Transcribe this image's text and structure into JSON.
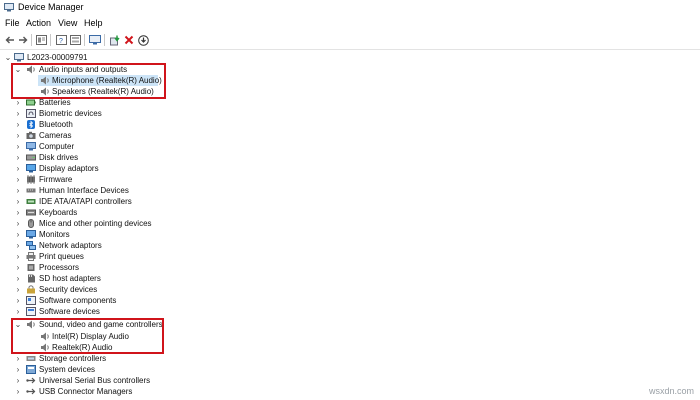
{
  "window": {
    "title": "Device Manager"
  },
  "menu": [
    "File",
    "Action",
    "View",
    "Help"
  ],
  "toolbar_icons": [
    "back-arrow-icon",
    "forward-arrow-icon",
    "properties-panel-icon",
    "help-book-icon",
    "show-hidden-icon",
    "monitor-icon",
    "update-driver-icon",
    "uninstall-x-icon",
    "scan-hardware-icon"
  ],
  "tree": {
    "root": "L2023-00009791",
    "nodes": [
      {
        "label": "Audio inputs and outputs",
        "expanded": true,
        "icon": "speaker-icon",
        "children": [
          {
            "label": "Microphone (Realtek(R) Audio)",
            "selected": true,
            "icon": "speaker-icon"
          },
          {
            "label": "Speakers (Realtek(R) Audio)",
            "icon": "speaker-icon"
          }
        ]
      },
      {
        "label": "Batteries",
        "icon": "battery-icon"
      },
      {
        "label": "Biometric devices",
        "icon": "fingerprint-icon"
      },
      {
        "label": "Bluetooth",
        "icon": "bluetooth-icon"
      },
      {
        "label": "Cameras",
        "icon": "camera-icon"
      },
      {
        "label": "Computer",
        "icon": "computer-icon"
      },
      {
        "label": "Disk drives",
        "icon": "disk-icon"
      },
      {
        "label": "Display adaptors",
        "icon": "display-adapter-icon"
      },
      {
        "label": "Firmware",
        "icon": "firmware-icon"
      },
      {
        "label": "Human Interface Devices",
        "icon": "hid-icon"
      },
      {
        "label": "IDE ATA/ATAPI controllers",
        "icon": "ide-controller-icon"
      },
      {
        "label": "Keyboards",
        "icon": "keyboard-icon"
      },
      {
        "label": "Mice and other pointing devices",
        "icon": "mouse-icon"
      },
      {
        "label": "Monitors",
        "icon": "monitor-icon"
      },
      {
        "label": "Network adaptors",
        "icon": "network-icon"
      },
      {
        "label": "Print queues",
        "icon": "printer-icon"
      },
      {
        "label": "Processors",
        "icon": "processor-icon"
      },
      {
        "label": "SD host adapters",
        "icon": "sd-card-icon"
      },
      {
        "label": "Security devices",
        "icon": "security-icon"
      },
      {
        "label": "Software components",
        "icon": "software-component-icon"
      },
      {
        "label": "Software devices",
        "icon": "software-device-icon"
      },
      {
        "label": "Sound, video and game controllers",
        "expanded": true,
        "icon": "speaker-icon",
        "children": [
          {
            "label": "Intel(R) Display Audio",
            "icon": "speaker-icon"
          },
          {
            "label": "Realtek(R) Audio",
            "icon": "speaker-icon"
          }
        ]
      },
      {
        "label": "Storage controllers",
        "icon": "storage-icon"
      },
      {
        "label": "System devices",
        "icon": "system-device-icon"
      },
      {
        "label": "Universal Serial Bus controllers",
        "icon": "usb-icon"
      },
      {
        "label": "USB Connector Managers",
        "icon": "usb-icon"
      }
    ]
  },
  "watermark": "wsxdn.com",
  "colors": {
    "highlight": "#d0141b",
    "selection": "#cce4f7"
  }
}
